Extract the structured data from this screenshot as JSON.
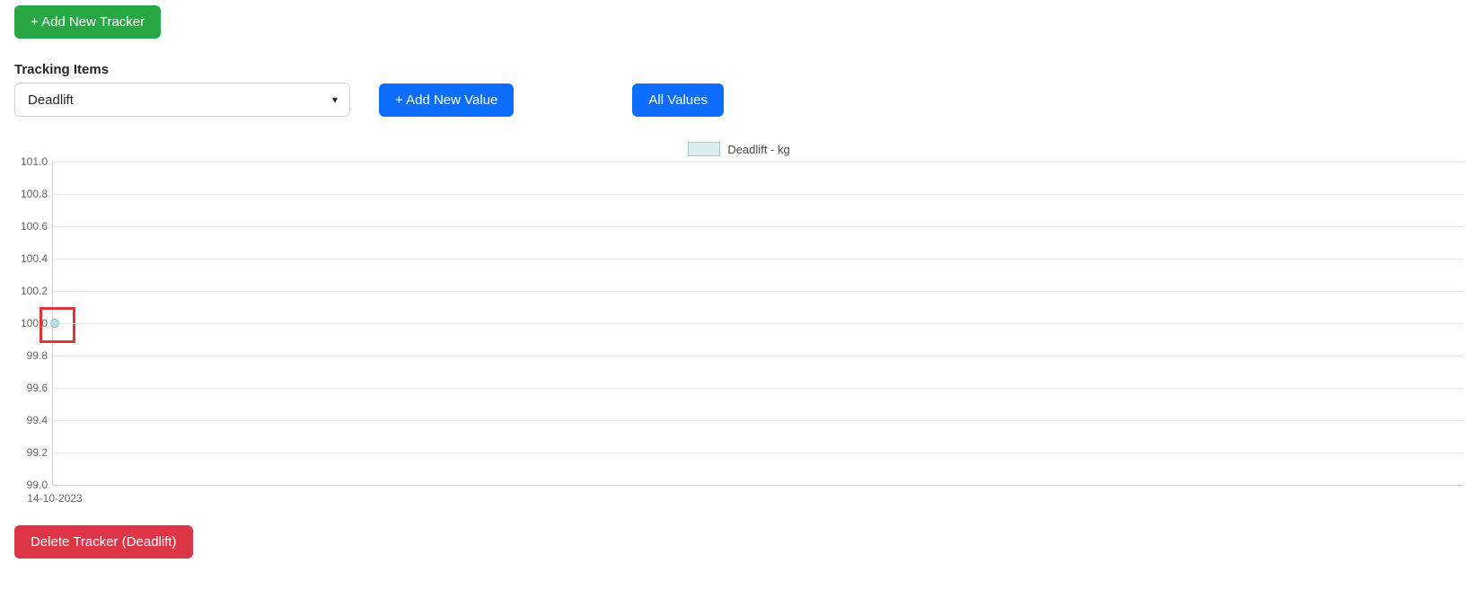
{
  "buttons": {
    "add_tracker": "+ Add New Tracker",
    "add_value": "+ Add New Value",
    "all_values": "All Values",
    "delete_tracker": "Delete Tracker (Deadlift)"
  },
  "labels": {
    "tracking_items": "Tracking Items"
  },
  "select": {
    "selected": "Deadlift",
    "options": [
      "Deadlift"
    ]
  },
  "legend": {
    "label": "Deadlift - kg"
  },
  "chart_data": {
    "type": "line",
    "title": "",
    "xlabel": "",
    "ylabel": "",
    "ylim": [
      99.0,
      101.0
    ],
    "y_ticks": [
      101.0,
      100.8,
      100.6,
      100.4,
      100.2,
      100.0,
      99.8,
      99.6,
      99.4,
      99.2,
      99.0
    ],
    "y_tick_labels": [
      "101.0",
      "100.8",
      "100.6",
      "100.4",
      "100.2",
      "100.0",
      "99.8",
      "99.6",
      "99.4",
      "99.2",
      "99.0"
    ],
    "categories": [
      "14-10-2023"
    ],
    "series": [
      {
        "name": "Deadlift - kg",
        "values": [
          100.0
        ]
      }
    ]
  }
}
